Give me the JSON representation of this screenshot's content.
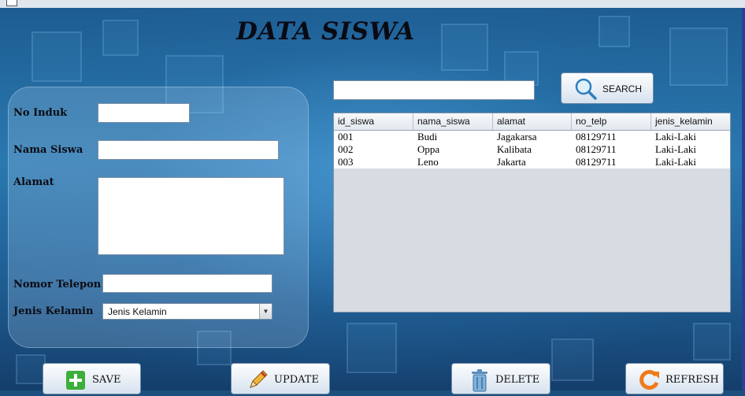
{
  "title": "DATA SISWA",
  "form": {
    "labels": {
      "no_induk": "No Induk",
      "nama_siswa": "Nama Siswa",
      "alamat": "Alamat",
      "nomor_telepon": "Nomor Telepon",
      "jenis_kelamin": "Jenis Kelamin"
    },
    "values": {
      "no_induk": "",
      "nama_siswa": "",
      "alamat": "",
      "nomor_telepon": ""
    },
    "jenis_kelamin_selected": "Jenis Kelamin"
  },
  "search": {
    "value": "",
    "button_label": "SEARCH"
  },
  "table": {
    "columns": [
      "id_siswa",
      "nama_siswa",
      "alamat",
      "no_telp",
      "jenis_kelamin"
    ],
    "rows": [
      [
        "001",
        "Budi",
        "Jagakarsa",
        "08129711",
        "Laki-Laki"
      ],
      [
        "002",
        "Oppa",
        "Kalibata",
        "08129711",
        "Laki-Laki"
      ],
      [
        "003",
        "Leno",
        "Jakarta",
        "08129711",
        "Laki-Laki"
      ]
    ]
  },
  "buttons": {
    "save": "SAVE",
    "update": "UPDATE",
    "delete": "DELETE",
    "refresh": "REFRESH"
  },
  "icons": {
    "search": "magnifier-icon",
    "save": "plus-icon",
    "update": "pencil-icon",
    "delete": "trash-icon",
    "refresh": "refresh-icon"
  },
  "colors": {
    "background": "#1f5f95",
    "save_icon": "#3cae3a",
    "refresh_icon": "#f07a1a"
  }
}
